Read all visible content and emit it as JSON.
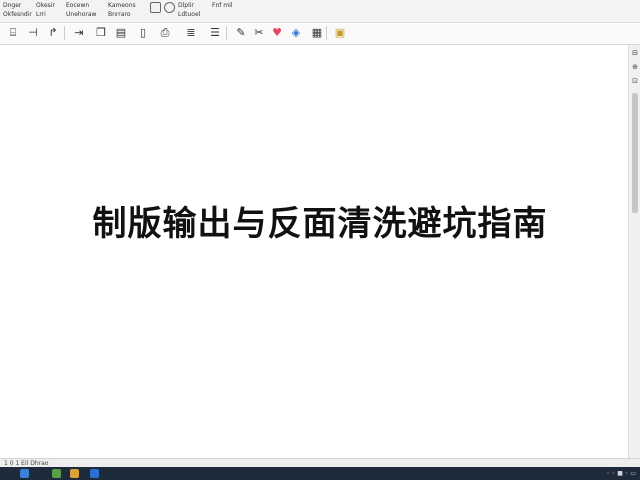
{
  "menu": {
    "col1": [
      "Dnger",
      "Okfesndir"
    ],
    "col2": [
      "Okesir",
      "Lrri"
    ],
    "col3": [
      "Eocewn",
      "Unehoraw"
    ],
    "col4": [
      "Kameons",
      "Bnrraro"
    ],
    "col5": [
      "Dlplir",
      "Ldtuoel"
    ],
    "col6": [
      "",
      "Fnf mil"
    ]
  },
  "document": {
    "headline": "制版输出与反面清洗避坑指南"
  },
  "status": {
    "text": "1 0 1 Eil   Dhrao"
  },
  "tray": {
    "text": "◦ ◦ ■ ◦ ▭"
  },
  "colors": {
    "taskbar": "#1e2b3a",
    "heart": "#e64664",
    "accent_blue": "#2b6fd6"
  }
}
